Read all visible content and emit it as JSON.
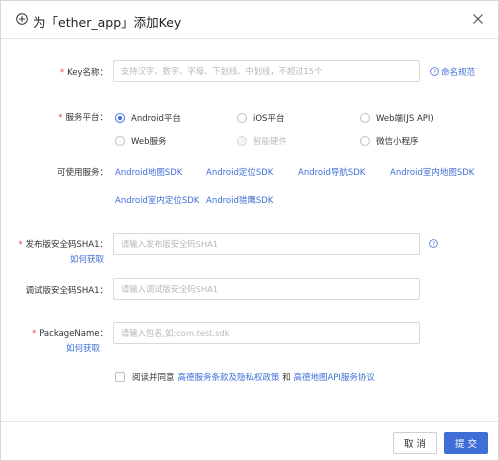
{
  "dialog": {
    "title": "为「ether_app」添加Key"
  },
  "key_name": {
    "label": "Key名称：",
    "placeholder": "支持汉字、数字、字母、下划线、中划线，不超过15个",
    "help_link": "命名规范"
  },
  "platform": {
    "label": "服务平台：",
    "options": [
      {
        "label": "Android平台",
        "checked": true,
        "disabled": false
      },
      {
        "label": "iOS平台",
        "checked": false,
        "disabled": false
      },
      {
        "label": "Web端(JS API)",
        "checked": false,
        "disabled": false
      },
      {
        "label": "Web服务",
        "checked": false,
        "disabled": false
      },
      {
        "label": "智能硬件",
        "checked": false,
        "disabled": true
      },
      {
        "label": "微信小程序",
        "checked": false,
        "disabled": false
      }
    ]
  },
  "available": {
    "label": "可使用服务：",
    "services": [
      "Android地图SDK",
      "Android定位SDK",
      "Android导航SDK",
      "Android室内地图SDK",
      "Android室内定位SDK",
      "Android猎鹰SDK"
    ]
  },
  "release_sha1": {
    "label": "发布版安全码SHA1：",
    "how_link": "如何获取",
    "placeholder": "请输入发布版安全码SHA1"
  },
  "debug_sha1": {
    "label": "调试版安全码SHA1：",
    "placeholder": "请输入调试版安全码SHA1"
  },
  "package": {
    "label": "PackageName：",
    "how_link": "如何获取",
    "placeholder": "请输入包名,如:com.test.sdk"
  },
  "agreement": {
    "prefix": "阅读并同意",
    "link1": "高德服务条款及隐私权政策",
    "and": " 和 ",
    "link2": "高德地图API服务协议"
  },
  "footer": {
    "cancel": "取 消",
    "submit": "提 交"
  },
  "colors": {
    "accent": "#3f6ed6",
    "required": "#e64340"
  }
}
